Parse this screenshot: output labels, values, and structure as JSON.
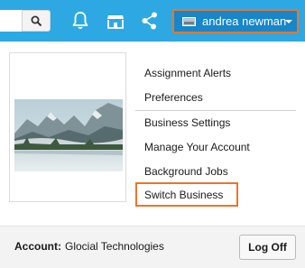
{
  "header": {
    "icons": [
      "search-icon",
      "bell-icon",
      "store-icon",
      "share-icon"
    ],
    "user_menu": {
      "name": "andrea newman",
      "caret_icon": "caret-down-icon"
    },
    "accent_color": "#2ea8e2",
    "highlight_color": "#e8762c"
  },
  "dropdown": {
    "image": "mountain-lake-photo",
    "menu_items": [
      "Assignment Alerts",
      "Preferences",
      "Business Settings",
      "Manage Your Account",
      "Background Jobs",
      "Switch Business"
    ],
    "highlighted_item": "Switch Business"
  },
  "footer": {
    "account_label": "Account:",
    "account_value": "Glocial Technologies",
    "logoff_label": "Log Off"
  }
}
